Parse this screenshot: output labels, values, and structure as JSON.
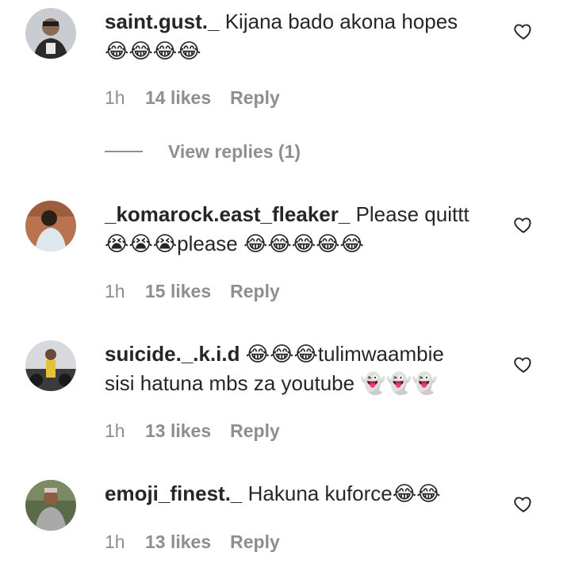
{
  "comments": [
    {
      "username": "saint.gust._",
      "text": "Kijana bado akona hopes",
      "line2": "😂😂😂😂",
      "time": "1h",
      "likes": "14 likes",
      "reply": "Reply",
      "avatar_icon": "user-avatar-photo"
    },
    {
      "username": "_komarock.east_fleaker_",
      "text": "Please quittt",
      "line2": "😭😭😭please 😂😂😂😂😂",
      "time": "1h",
      "likes": "15 likes",
      "reply": "Reply",
      "avatar_icon": "user-avatar-photo"
    },
    {
      "username": "suicide._.k.i.d",
      "text": "😂😂😂tulimwaambie",
      "line2": "sisi hatuna mbs za youtube 👻👻👻",
      "time": "1h",
      "likes": "13 likes",
      "reply": "Reply",
      "avatar_icon": "user-avatar-photo"
    },
    {
      "username": "emoji_finest._",
      "text": "Hakuna kuforce😂😂",
      "line2": "",
      "time": "1h",
      "likes": "13 likes",
      "reply": "Reply",
      "avatar_icon": "user-avatar-photo"
    }
  ],
  "view_replies": "View replies (1)",
  "colors": {
    "text": "#262626",
    "meta": "#8e8e8e",
    "background": "#ffffff"
  }
}
